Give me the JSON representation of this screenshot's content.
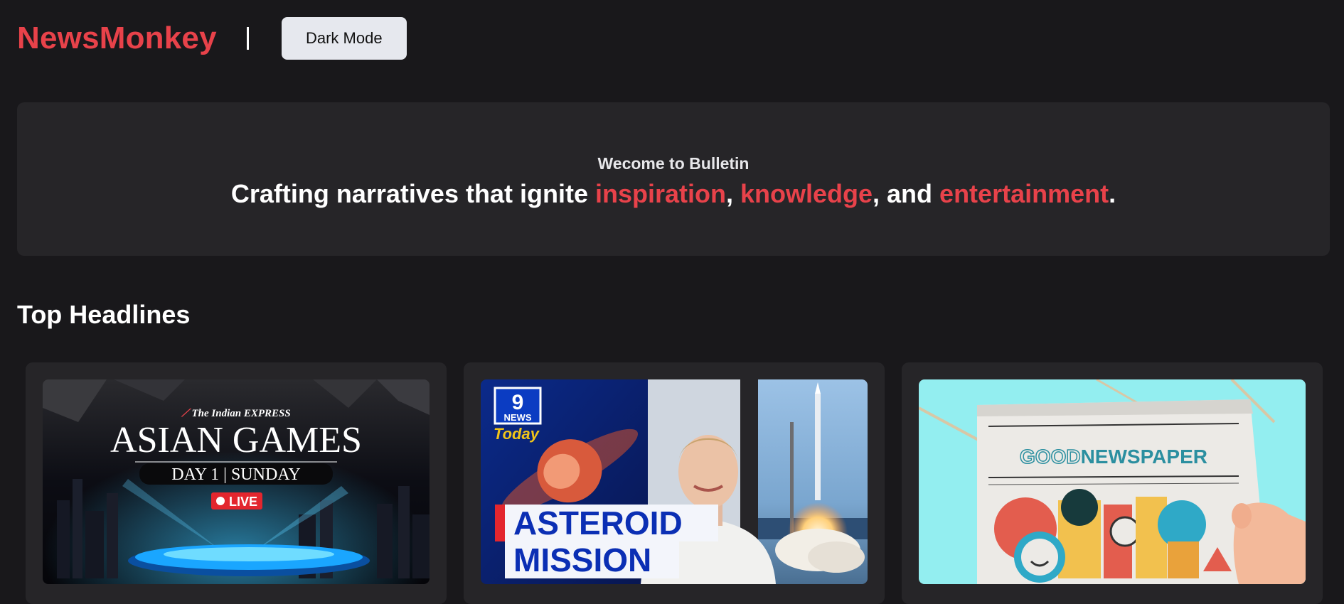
{
  "navbar": {
    "brand": "NewsMonkey",
    "separator": "|",
    "dark_mode_label": "Dark Mode"
  },
  "hero": {
    "welcome": "Wecome to Bulletin",
    "tagline": {
      "prefix": "Crafting narratives that ignite ",
      "word1": "inspiration",
      "sep1": ", ",
      "word2": "knowledge",
      "sep2": ", and ",
      "word3": "entertainment",
      "suffix": "."
    }
  },
  "section": {
    "title": "Top Headlines"
  },
  "cards": [
    {
      "image": {
        "publisher": "The Indian EXPRESS",
        "title": "ASIAN GAMES",
        "subtitle": "DAY 1 | SUNDAY",
        "badge": "LIVE"
      }
    },
    {
      "image": {
        "logo_top": "9",
        "logo_mid": "NEWS",
        "logo_bottom": "Today",
        "line1": "ASTEROID",
        "line2": "MISSION"
      }
    },
    {
      "image": {
        "masthead_a": "GOOD",
        "masthead_b": "NEWSPAPER"
      }
    }
  ],
  "colors": {
    "background": "#19181b",
    "panel": "#262528",
    "accent": "#e8424a",
    "button": "#e6e8ee"
  }
}
